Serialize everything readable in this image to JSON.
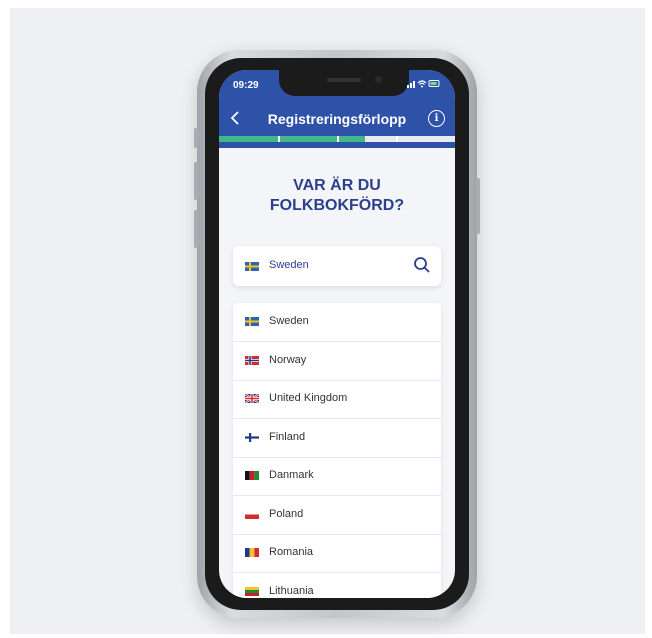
{
  "status_bar": {
    "time": "09:29",
    "icons": [
      "signal-icon",
      "wifi-icon",
      "battery-icon"
    ]
  },
  "header": {
    "title": "Registreringsförlopp",
    "back_icon": "chevron-left-icon",
    "info_icon": "info-icon",
    "info_symbol": "i"
  },
  "progress": {
    "steps": 4,
    "completed_fraction": 0.62
  },
  "colors": {
    "brand": "#2f52a9",
    "accent": "#41b88a",
    "heading": "#2b3f8e"
  },
  "headline": {
    "line1": "VAR ÄR DU",
    "line2": "FOLKBOKFÖRD?"
  },
  "search": {
    "value": "Sweden",
    "icon": "search-icon"
  },
  "countries": [
    {
      "label": "Sweden",
      "flag": "sweden"
    },
    {
      "label": "Norway",
      "flag": "norway"
    },
    {
      "label": "United Kingdom",
      "flag": "uk"
    },
    {
      "label": "Finland",
      "flag": "finland"
    },
    {
      "label": "Danmark",
      "flag": "afghanistan"
    },
    {
      "label": "Poland",
      "flag": "poland"
    },
    {
      "label": "Romania",
      "flag": "romania"
    },
    {
      "label": "Lithuania",
      "flag": "lithuania"
    }
  ]
}
